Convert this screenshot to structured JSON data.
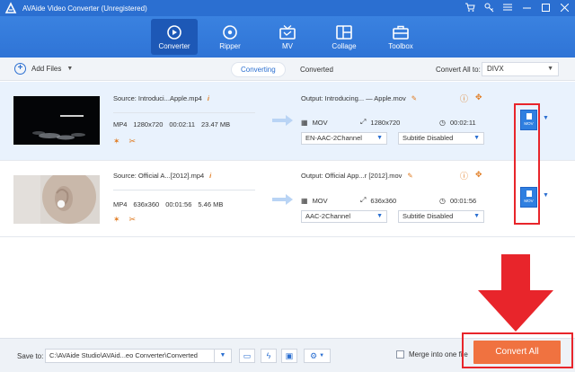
{
  "titlebar": {
    "title": "AVAide Video Converter (Unregistered)",
    "controls": [
      "cart-icon",
      "key-icon",
      "menu-icon",
      "minimize-icon",
      "maximize-icon",
      "close-icon"
    ]
  },
  "nav": {
    "tabs": [
      {
        "label": "Converter",
        "icon": "converter-icon",
        "active": true
      },
      {
        "label": "Ripper",
        "icon": "ripper-icon",
        "active": false
      },
      {
        "label": "MV",
        "icon": "tv-icon",
        "active": false
      },
      {
        "label": "Collage",
        "icon": "collage-icon",
        "active": false
      },
      {
        "label": "Toolbox",
        "icon": "toolbox-icon",
        "active": false
      }
    ]
  },
  "toolbar": {
    "add_files": "Add Files",
    "tab_converting": "Converting",
    "tab_converted": "Converted",
    "convert_all_to_label": "Convert All to:",
    "convert_all_to_value": "DIVX"
  },
  "files": [
    {
      "source": "Source: Introduci...Apple.mp4",
      "format": "MP4",
      "resolution": "1280x720",
      "duration": "00:02:11",
      "size": "23.47 MB",
      "output": "Output: Introducing... — Apple.mov",
      "out_format": "MOV",
      "out_resolution": "1280x720",
      "out_duration": "00:02:11",
      "audio": "EN-AAC-2Channel",
      "subtitle": "Subtitle Disabled",
      "format_button": "MOV"
    },
    {
      "source": "Source: Official A...[2012].mp4",
      "format": "MP4",
      "resolution": "636x360",
      "duration": "00:01:56",
      "size": "5.46 MB",
      "output": "Output: Official App...r [2012].mov",
      "out_format": "MOV",
      "out_resolution": "636x360",
      "out_duration": "00:01:56",
      "audio": "AAC-2Channel",
      "subtitle": "Subtitle Disabled",
      "format_button": "MOV"
    }
  ],
  "bottom": {
    "save_to_label": "Save to:",
    "save_path": "C:\\AVAide Studio\\AVAid...eo Converter\\Converted",
    "merge_label": "Merge into one file",
    "convert_all": "Convert All"
  },
  "colors": {
    "brand_blue": "#2b6fd1",
    "accent_orange": "#f07240",
    "highlight_red": "#e8252b"
  }
}
